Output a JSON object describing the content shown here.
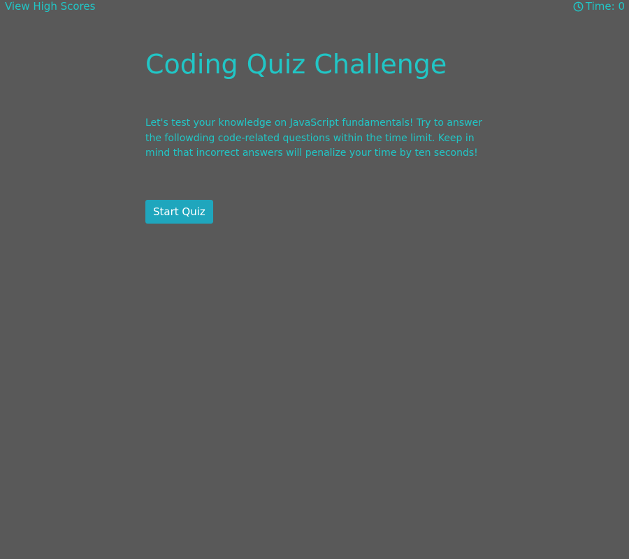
{
  "header": {
    "high_scores_label": "View High Scores",
    "timer_label": "Time: 0"
  },
  "main": {
    "title": "Coding Quiz Challenge",
    "intro": "Let's test your knowledge on JavaScript fundamentals! Try to answer the followding code-related questions within the time limit. Keep in mind that incorrect answers will penalize your time by ten seconds!",
    "start_button_label": "Start Quiz"
  },
  "icons": {
    "timer": "clock-icon"
  },
  "colors": {
    "background": "#595959",
    "accent": "#21c6c6",
    "button": "#1fa6bd",
    "button_text": "#ffffff"
  }
}
